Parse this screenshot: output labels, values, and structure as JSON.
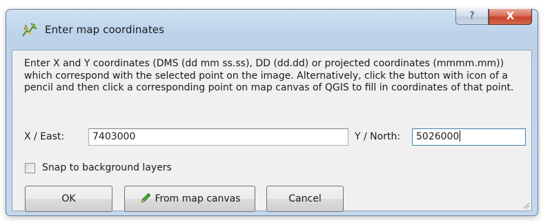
{
  "window": {
    "title": "Enter map coordinates",
    "title_icon": "georeferencer-icon",
    "help_label": "?",
    "close_label": "X"
  },
  "dialog": {
    "description": "Enter X and Y coordinates (DMS (dd mm ss.ss), DD (dd.dd) or projected coordinates (mmmm.mm)) which correspond with the selected point on the image. Alternatively, click the button with icon of a pencil and then click a corresponding point on map canvas of QGIS to fill in coordinates of that point.",
    "x_label": "X / East:",
    "x_value": "7403000",
    "y_label": "Y / North:",
    "y_value": "5026000",
    "snap_label": "Snap to background layers",
    "snap_checked": false
  },
  "buttons": {
    "ok": "OK",
    "from_map_canvas": "From map canvas",
    "from_map_canvas_icon": "pencil-icon",
    "cancel": "Cancel"
  },
  "colors": {
    "frame": "#c4d8ee",
    "client": "#f0f0f0",
    "close": "#c7422a",
    "focus": "#3c7fb1",
    "pencil": "#3a9a2a"
  }
}
